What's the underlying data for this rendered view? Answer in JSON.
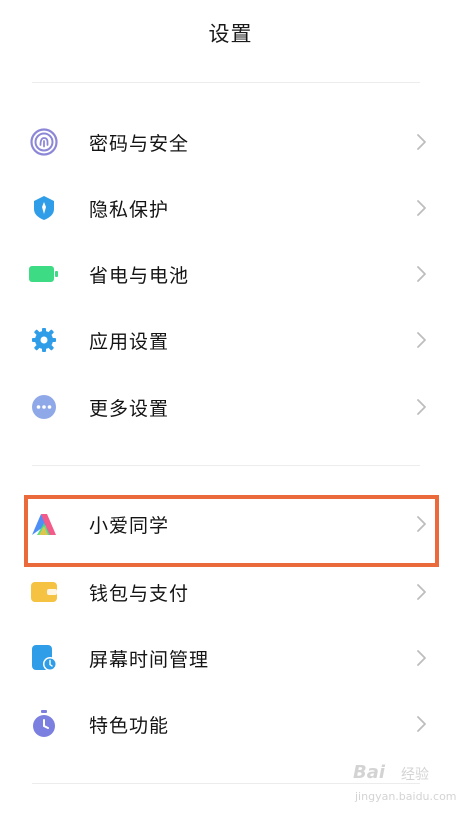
{
  "header": {
    "title": "设置"
  },
  "groups": [
    {
      "items": [
        {
          "label": "密码与安全",
          "icon": "fingerprint-icon"
        },
        {
          "label": "隐私保护",
          "icon": "privacy-shield-icon"
        },
        {
          "label": "省电与电池",
          "icon": "battery-icon"
        },
        {
          "label": "应用设置",
          "icon": "gear-icon"
        },
        {
          "label": "更多设置",
          "icon": "more-dots-icon"
        }
      ]
    },
    {
      "items": [
        {
          "label": "小爱同学",
          "icon": "xiaoai-assistant-icon",
          "highlighted": true
        },
        {
          "label": "钱包与支付",
          "icon": "wallet-icon"
        },
        {
          "label": "屏幕时间管理",
          "icon": "screen-time-icon"
        },
        {
          "label": "特色功能",
          "icon": "stopwatch-icon"
        }
      ]
    }
  ],
  "colors": {
    "highlight_border": "#ea6a3b",
    "security_icon": "#8c87d6",
    "privacy_icon": "#2f9de8",
    "battery_icon": "#3ddc84",
    "settings_icon": "#2f9de8",
    "more_icon": "#8fa8e8",
    "wallet_icon": "#f5c242",
    "screen_time_icon": "#2f9de8",
    "features_icon": "#7b7fe0"
  },
  "watermark": {
    "brand": "Bai",
    "text": "经验",
    "url": "jingyan.baidu.com"
  }
}
